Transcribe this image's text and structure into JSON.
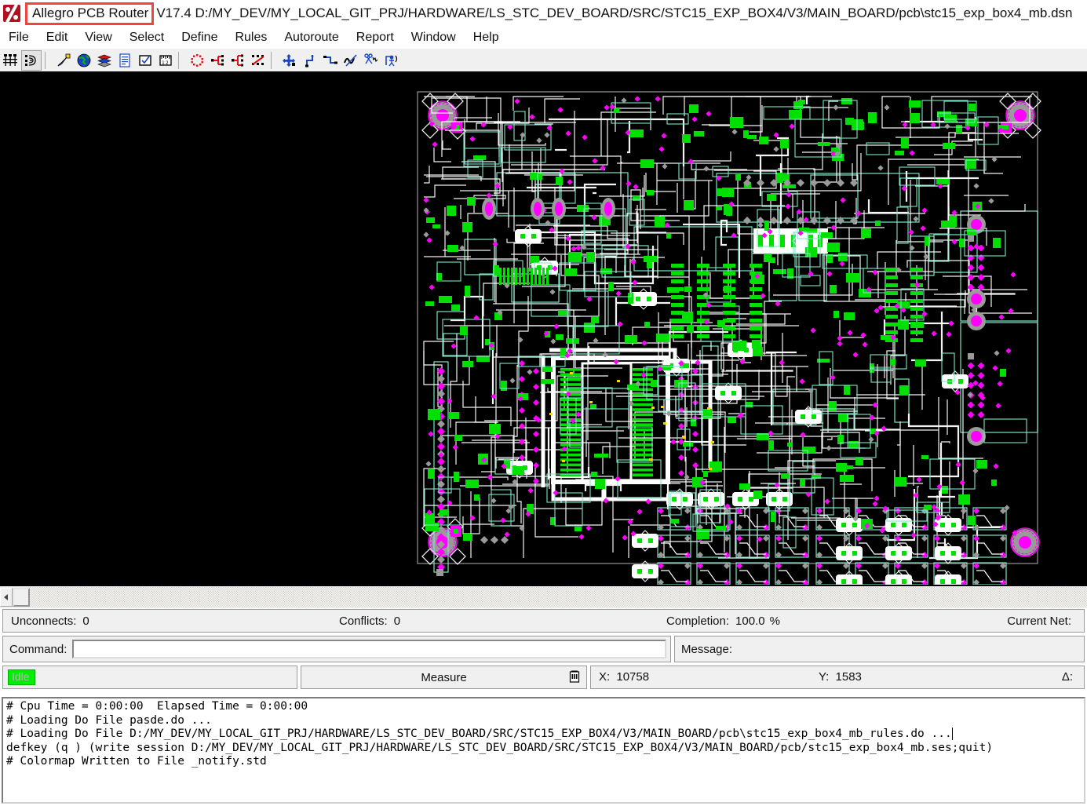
{
  "window": {
    "icon": "allegro-logo-icon",
    "title_highlighted": "Allegro PCB Router",
    "title_rest": "V17.4 D:/MY_DEV/MY_LOCAL_GIT_PRJ/HARDWARE/LS_STC_DEV_BOARD/SRC/STC15_EXP_BOX4/V3/MAIN_BOARD/pcb\\stc15_exp_box4_mb.dsn",
    "highlight_color": "#f4433a"
  },
  "menubar": {
    "items": [
      {
        "label": "File"
      },
      {
        "label": "Edit"
      },
      {
        "label": "View"
      },
      {
        "label": "Select"
      },
      {
        "label": "Define"
      },
      {
        "label": "Rules"
      },
      {
        "label": "Autoroute"
      },
      {
        "label": "Report"
      },
      {
        "label": "Window"
      },
      {
        "label": "Help"
      }
    ]
  },
  "toolbar": {
    "groups": [
      {
        "buttons": [
          {
            "icon": "layers-stackup-icon",
            "active": false
          },
          {
            "icon": "route-wires-icon",
            "active": true
          }
        ]
      },
      {
        "buttons": [
          {
            "icon": "highlight-pen-icon",
            "active": false
          },
          {
            "icon": "globe-world-icon",
            "active": false
          },
          {
            "icon": "layer-stack-icon",
            "active": false
          },
          {
            "icon": "report-document-icon",
            "active": false
          },
          {
            "icon": "checkbox-options-icon",
            "active": false
          },
          {
            "icon": "ruler-measure-icon",
            "active": false
          }
        ]
      },
      {
        "buttons": [
          {
            "icon": "route-ring-icon",
            "active": false
          },
          {
            "icon": "fanout-icon",
            "active": false
          },
          {
            "icon": "bus-route-icon",
            "active": false
          },
          {
            "icon": "diagonal-route-icon",
            "active": false
          }
        ]
      },
      {
        "buttons": [
          {
            "icon": "move-arrows-icon",
            "active": false
          },
          {
            "icon": "add-segment-icon",
            "active": false
          },
          {
            "icon": "shape-route-icon",
            "active": false
          },
          {
            "icon": "smooth-wire-icon",
            "active": false
          },
          {
            "icon": "scissors-cut-icon",
            "active": false
          },
          {
            "icon": "critic-wires-icon",
            "active": false
          }
        ]
      }
    ]
  },
  "canvas": {
    "background": "#000000",
    "board_outline_color": "#808080",
    "trace_color": "#ffffff",
    "pad_color": "#ff00ff",
    "smd_pad_color": "#00e000",
    "outline_color": "#7fe6c8",
    "via_color": "#9a9a9a"
  },
  "scrollbar": {
    "left_arrow": "scroll-left-icon",
    "thumb": "scroll-thumb"
  },
  "status": {
    "unconnects_label": "Unconnects:",
    "unconnects_value": "0",
    "conflicts_label": "Conflicts:",
    "conflicts_value": "0",
    "completion_label": "Completion:",
    "completion_value": "100.0",
    "completion_unit": "%",
    "current_net_label": "Current Net:",
    "current_net_value": "",
    "command_label": "Command:",
    "command_value": "",
    "command_placeholder": "",
    "message_label": "Message:",
    "message_value": "",
    "idle_label": "Idle",
    "measure_label": "Measure",
    "measure_icon": "measure-tool-icon",
    "x_label": "X:",
    "x_value": "10758",
    "y_label": "Y:",
    "y_value": "1583",
    "delta_label": "Δ:",
    "delta_value": ""
  },
  "console": {
    "lines": [
      "# Cpu Time = 0:00:00  Elapsed Time = 0:00:00",
      "# Loading Do File pasde.do ...",
      "# Loading Do File D:/MY_DEV/MY_LOCAL_GIT_PRJ/HARDWARE/LS_STC_DEV_BOARD/SRC/STC15_EXP_BOX4/V3/MAIN_BOARD/pcb\\stc15_exp_box4_mb_rules.do ...",
      "defkey (q ) (write session D:/MY_DEV/MY_LOCAL_GIT_PRJ/HARDWARE/LS_STC_DEV_BOARD/SRC/STC15_EXP_BOX4/V3/MAIN_BOARD/pcb/stc15_exp_box4_mb.ses;quit)",
      "# Colormap Written to File _notify.std"
    ]
  }
}
